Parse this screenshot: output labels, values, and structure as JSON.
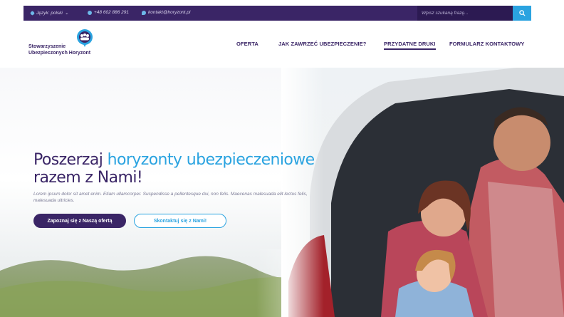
{
  "topbar": {
    "language": "Język: polski",
    "language_chevron": "⌄",
    "phone": "+48 602 886 291",
    "email": "kontakt@horyzont.pl",
    "search_placeholder": "Wpisz szukaną frazę..."
  },
  "logo": {
    "line1": "Stowarzyszenie",
    "line2": "Ubezpieczonych Horyzont"
  },
  "nav": {
    "items": [
      "OFERTA",
      "JAK ZAWRZEĆ UBEZPIECZENIE?",
      "PRZYDATNE DRUKI",
      "FORMULARZ KONTAKTOWY"
    ],
    "active_index": 2
  },
  "hero": {
    "headline_part1": "Poszerzaj ",
    "headline_highlight": "horyzonty ubezpieczeniowe",
    "headline_line2": "razem z Nami!",
    "lorem": "Lorem ipsum dolor sit amet enim. Etiam ullamcorper. Suspendisse a pellentesque dui, non felis. Maecenas malesuada elit lectus felis, malesuada ultricies.",
    "primary_button": "Zapoznaj się z Naszą ofertą",
    "secondary_button": "Skontaktuj się z Nami!"
  },
  "colors": {
    "brand_purple": "#3a2566",
    "accent_blue": "#2aa3e0"
  },
  "icons": [
    "gear-icon",
    "phone-icon",
    "chat-icon",
    "search-icon",
    "logo-icon"
  ]
}
